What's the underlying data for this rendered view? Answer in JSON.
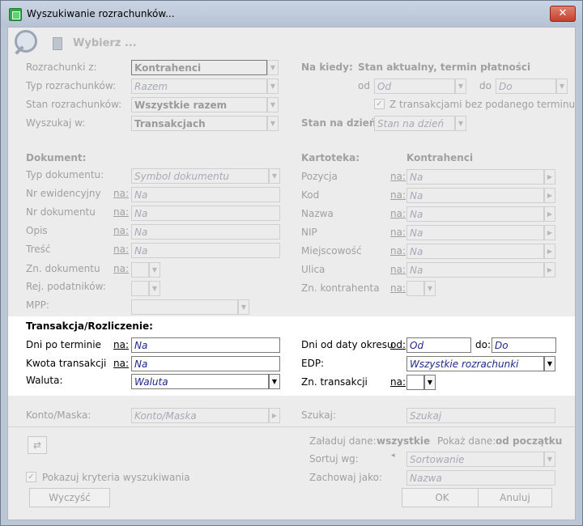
{
  "window": {
    "title": "Wyszukiwanie rozrachunków..."
  },
  "toolbar": {
    "label": "Wybierz ..."
  },
  "top": {
    "rozrachunki_label": "Rozrachunki z:",
    "rozrachunki_value": "Kontrahenci",
    "typ_label": "Typ rozrachunków:",
    "typ_value": "Razem",
    "stan_label": "Stan rozrachunków:",
    "stan_value": "Wszystkie razem",
    "wyszukaj_label": "Wyszukaj w:",
    "wyszukaj_value": "Transakcjach",
    "na_kiedy_label": "Na kiedy:",
    "na_kiedy_value": "Stan aktualny, termin płatności",
    "od_label": "od",
    "od_placeholder": "Od",
    "do_label": "do",
    "do_placeholder": "Do",
    "z_transakcjami_label": "Z transakcjami bez podanego terminu",
    "stan_na_dzien_label": "Stan na dzień:",
    "stan_na_dzien_placeholder": "Stan na dzień"
  },
  "dokument": {
    "header": "Dokument:",
    "typ_label": "Typ dokumentu:",
    "typ_placeholder": "Symbol dokumentu",
    "nr_ewid_label": "Nr ewidencyjny",
    "nr_dok_label": "Nr dokumentu",
    "opis_label": "Opis",
    "tresc_label": "Treść",
    "zn_dok_label": "Zn. dokumentu",
    "rej_label": "Rej. podatników:",
    "mpp_label": "MPP:",
    "na": "na:",
    "na_placeholder": "Na"
  },
  "kartoteka": {
    "header": "Kartoteka:",
    "header_value": "Kontrahenci",
    "pozycja_label": "Pozycja",
    "kod_label": "Kod",
    "nazwa_label": "Nazwa",
    "nip_label": "NIP",
    "miejscowosc_label": "Miejscowość",
    "ulica_label": "Ulica",
    "zn_kontr_label": "Zn. kontrahenta",
    "na": "na:",
    "na_placeholder": "Na"
  },
  "transakcja": {
    "header": "Transakcja/Rozliczenie:",
    "dni_label": "Dni po terminie",
    "dni_na": "na:",
    "dni_placeholder": "Na",
    "kwota_label": "Kwota transakcji",
    "kwota_na": "na:",
    "kwota_placeholder": "Na",
    "waluta_label": "Waluta:",
    "waluta_placeholder": "Waluta",
    "dni_od_label": "Dni od daty okresu",
    "od_label": "od:",
    "od_placeholder": "Od",
    "do_label": "do:",
    "do_placeholder": "Do",
    "edp_label": "EDP:",
    "edp_value": "Wszystkie rozrachunki",
    "zn_label": "Zn. transakcji",
    "zn_na": "na:"
  },
  "bottom": {
    "konto_label": "Konto/Maska:",
    "konto_placeholder": "Konto/Maska",
    "szukaj_label": "Szukaj:",
    "szukaj_placeholder": "Szukaj",
    "zaladuj_label": "Załaduj dane:",
    "zaladuj_value": "wszystkie",
    "pokaz_label": "Pokaż dane:",
    "pokaz_value": "od początku",
    "sortuj_label": "Sortuj wg:",
    "sortuj_placeholder": "Sortowanie",
    "zachowaj_label": "Zachowaj jako:",
    "zachowaj_placeholder": "Nazwa",
    "pokazuj_label": "Pokazuj kryteria wyszukiwania",
    "wyczysc": "Wyczyść",
    "ok": "OK",
    "anuluj": "Anuluj"
  }
}
